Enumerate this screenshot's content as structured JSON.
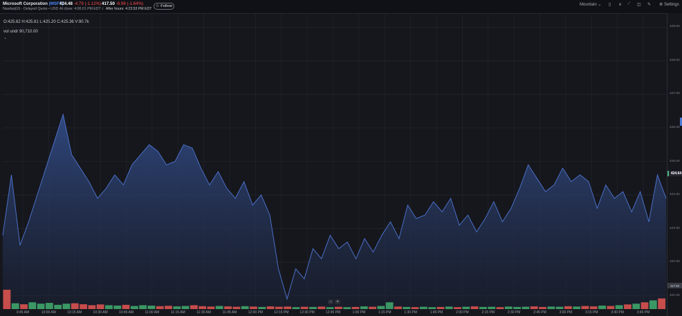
{
  "header": {
    "company_name": "Microsoft Corporation",
    "ticker": "(MSFT)",
    "exchange_info": "NasdaqGS - Delayed Quote • USD",
    "price": "424.48",
    "change": "-4.79",
    "change_pct": "(-1.12%)",
    "close_label": "At close: 4:00:01 PM EDT",
    "ah_price": "417.50",
    "ah_change": "-6.98",
    "ah_change_pct": "(-1.64%)",
    "ah_label": "After hours: 4:23:53 PM EDT",
    "follow_label": "Follow"
  },
  "toolbar": {
    "chart_type_label": "Mountain",
    "settings_label": "Settings"
  },
  "legend": {
    "ohlc": "O:425.62  H:425.81  L:425.20  C:425.36  V:90.7k",
    "volume": "vol undr  90,710.00"
  },
  "colors": {
    "accent": "#4d8cff",
    "line": "#3f5ca8",
    "up": "#3fa66a",
    "down": "#d9534f",
    "negative_text": "#ff4d4d"
  },
  "chart_data": {
    "type": "area",
    "y_ticks": [
      "429.00",
      "428.00",
      "427.00",
      "426.00",
      "425.00",
      "424.00",
      "423.00",
      "422.00",
      "421.00"
    ],
    "ylim": [
      420.6,
      429.4
    ],
    "x_ticks": [
      "9:45 AM",
      "10:00 AM",
      "10:15 AM",
      "10:30 AM",
      "10:45 AM",
      "11:00 AM",
      "11:15 AM",
      "11:30 AM",
      "11:45 AM",
      "12:00 PM",
      "12:15 PM",
      "12:30 PM",
      "12:45 PM",
      "1:00 PM",
      "1:15 PM",
      "1:30 PM",
      "1:45 PM",
      "2:00 PM",
      "2:15 PM",
      "2:30 PM",
      "2:45 PM",
      "3:00 PM",
      "3:15 PM",
      "3:30 PM",
      "3:45 PM"
    ],
    "last_price_label": "424.64",
    "ah_price_label": "417.50",
    "series": [
      {
        "values": [
          422.8,
          424.6,
          422.5,
          423.2,
          424.0,
          424.8,
          425.6,
          426.4,
          425.2,
          424.8,
          424.4,
          423.9,
          424.2,
          424.6,
          424.3,
          424.9,
          425.2,
          425.5,
          425.3,
          424.9,
          425.0,
          425.5,
          425.4,
          424.8,
          424.3,
          424.7,
          424.2,
          423.9,
          424.4,
          423.7,
          424.0,
          423.4,
          421.8,
          420.9,
          421.8,
          421.5,
          422.4,
          422.1,
          422.8,
          422.4,
          422.6,
          422.1,
          422.7,
          422.3,
          422.8,
          423.2,
          422.7,
          423.7,
          423.3,
          423.4,
          423.8,
          423.5,
          423.9,
          423.1,
          423.4,
          422.9,
          423.3,
          423.8,
          423.2,
          423.6,
          424.2,
          424.9,
          424.5,
          424.1,
          424.3,
          424.8,
          424.4,
          424.6,
          424.4,
          423.6,
          424.3,
          423.9,
          424.1,
          423.5,
          424.1,
          423.2,
          424.6,
          423.9
        ]
      }
    ],
    "volume": {
      "values": [
        1.0,
        0.3,
        0.25,
        0.35,
        0.28,
        0.32,
        0.22,
        0.28,
        0.3,
        0.25,
        0.2,
        0.24,
        0.2,
        0.18,
        0.22,
        0.16,
        0.2,
        0.18,
        0.15,
        0.17,
        0.14,
        0.16,
        0.2,
        0.15,
        0.13,
        0.16,
        0.14,
        0.12,
        0.15,
        0.13,
        0.11,
        0.14,
        0.12,
        0.13,
        0.1,
        0.12,
        0.11,
        0.13,
        0.1,
        0.12,
        0.1,
        0.11,
        0.14,
        0.12,
        0.16,
        0.35,
        0.13,
        0.11,
        0.1,
        0.12,
        0.1,
        0.11,
        0.13,
        0.1,
        0.12,
        0.14,
        0.11,
        0.12,
        0.1,
        0.13,
        0.11,
        0.12,
        0.14,
        0.11,
        0.13,
        0.12,
        0.15,
        0.13,
        0.16,
        0.14,
        0.18,
        0.16,
        0.2,
        0.24,
        0.28,
        0.35,
        0.45,
        0.55
      ]
    }
  }
}
